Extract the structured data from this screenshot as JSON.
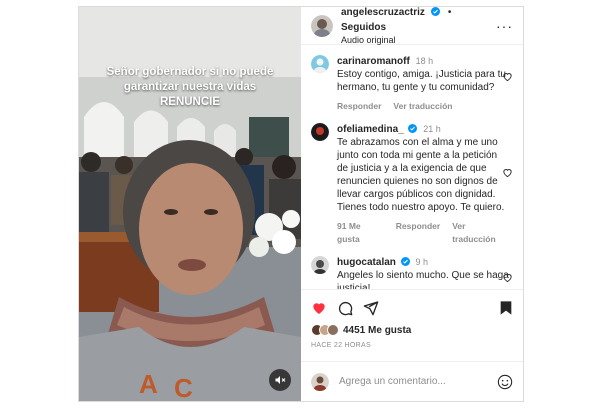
{
  "media": {
    "overlay_lines": [
      "Señor gobernador si no puede",
      "garantizar nuestra vidas",
      "RENUNCIE"
    ],
    "mute_icon": "speaker-muted-icon"
  },
  "header": {
    "username": "angelescruzactriz",
    "separator": "•",
    "follow_status": "Seguidos",
    "audio": "Audio original",
    "more_icon": "more-icon"
  },
  "comments": [
    {
      "username": "carinaromanoff",
      "verified": false,
      "time": "18 h",
      "text": "Estoy contigo, amiga. ¡Justicia para tu hermano, tu gente y tu comunidad?",
      "likes": "",
      "reply": "Responder",
      "translate": "Ver traducción"
    },
    {
      "username": "ofeliamedina_",
      "verified": true,
      "time": "21 h",
      "text": "Te abrazamos con el alma y me uno junto con toda mi gente a la petición de justicia y a la exigencia de que renuncien quienes no son dignos de llevar cargos públicos con dignidad. Tienes todo nuestro apoyo. Te quiero.",
      "likes": "91 Me gusta",
      "reply": "Responder",
      "translate": "Ver traducción"
    },
    {
      "username": "hugocatalan",
      "verified": true,
      "time": "9 h",
      "text": "Angeles lo siento mucho. Que se haga justicia!",
      "likes": "",
      "reply": "",
      "translate": ""
    }
  ],
  "actions": {
    "likes": "4451 Me gusta",
    "post_time": "HACE 22 HORAS",
    "icons": [
      "heart-filled-icon",
      "comment-icon",
      "share-icon",
      "bookmark-icon"
    ]
  },
  "add_comment": {
    "placeholder": "Agrega un comentario...",
    "emoji_icon": "emoji-icon"
  },
  "colors": {
    "heart": "#ff3040",
    "verified": "#0095f6",
    "border": "#dbdbdb",
    "secondary_text": "#8e8e8e"
  }
}
